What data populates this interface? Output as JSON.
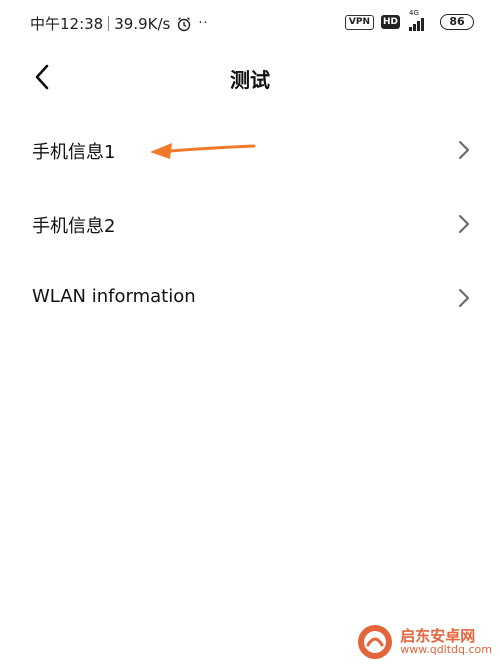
{
  "status_bar": {
    "time": "中午12:38",
    "net_speed": "39.9K/s",
    "dots": "··",
    "vpn": "VPN",
    "hd": "HD",
    "network_gen": "4G",
    "battery": "86",
    "icons": [
      "alarm-icon",
      "signal-icon",
      "battery-icon"
    ]
  },
  "header": {
    "title": "测试",
    "back_icon": "chevron-left-icon"
  },
  "list": {
    "items": [
      {
        "label": "手机信息1"
      },
      {
        "label": "手机信息2"
      },
      {
        "label": "WLAN information"
      }
    ]
  },
  "annotation": {
    "arrow_color": "#f07a2a"
  },
  "watermark": {
    "name": "启东安卓网",
    "url": "www.qdltdq.com",
    "color": "#e04a1a"
  }
}
